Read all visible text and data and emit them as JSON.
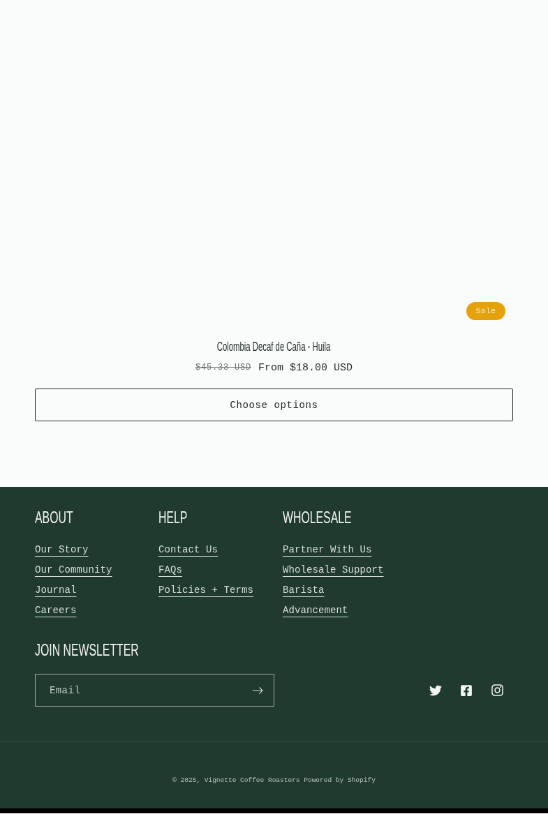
{
  "product": {
    "badge": "Sale",
    "title": "Colombia Decaf de Caña - Huila",
    "regular_price": "$45.33 USD",
    "sale_price": "From $18.00 USD",
    "button": "Choose options"
  },
  "footer": {
    "columns": [
      {
        "heading": "ABOUT",
        "links": [
          "Our Story",
          "Our Community",
          "Journal",
          "Careers"
        ]
      },
      {
        "heading": "HELP",
        "links": [
          "Contact Us",
          "FAQs",
          "Policies + Terms"
        ]
      },
      {
        "heading": "WHOLESALE",
        "links": [
          "Partner With Us",
          "Wholesale Support",
          "Barista",
          "Advancement"
        ]
      }
    ],
    "newsletter": {
      "heading": "JOIN NEWSLETTER",
      "placeholder": "Email"
    },
    "copyright": "© 2025,",
    "store_name": "Vignette Coffee Roasters",
    "powered_by": "Powered by Shopify"
  }
}
